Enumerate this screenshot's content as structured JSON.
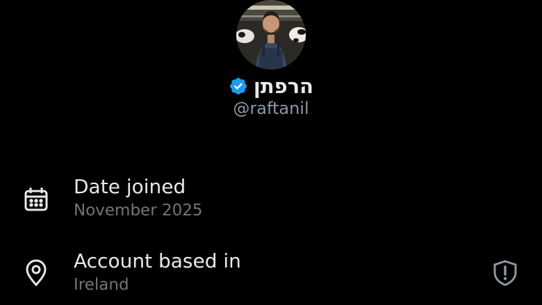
{
  "profile": {
    "display_name": "הרפתן",
    "handle": "@raftanil",
    "verified": true,
    "avatar_icon": "avatar-photo"
  },
  "about": {
    "rows": [
      {
        "icon": "calendar-icon",
        "title": "Date joined",
        "value": "November 2025"
      },
      {
        "icon": "location-pin-icon",
        "title": "Account based in",
        "value": "Ireland",
        "trailing_icon": "shield-alert-icon"
      }
    ]
  },
  "colors": {
    "background": "#000000",
    "primary_text": "#e7e9ea",
    "secondary_text": "#71767b",
    "verified_blue": "#1d9bf0",
    "icon_gray": "#8b98a5"
  }
}
